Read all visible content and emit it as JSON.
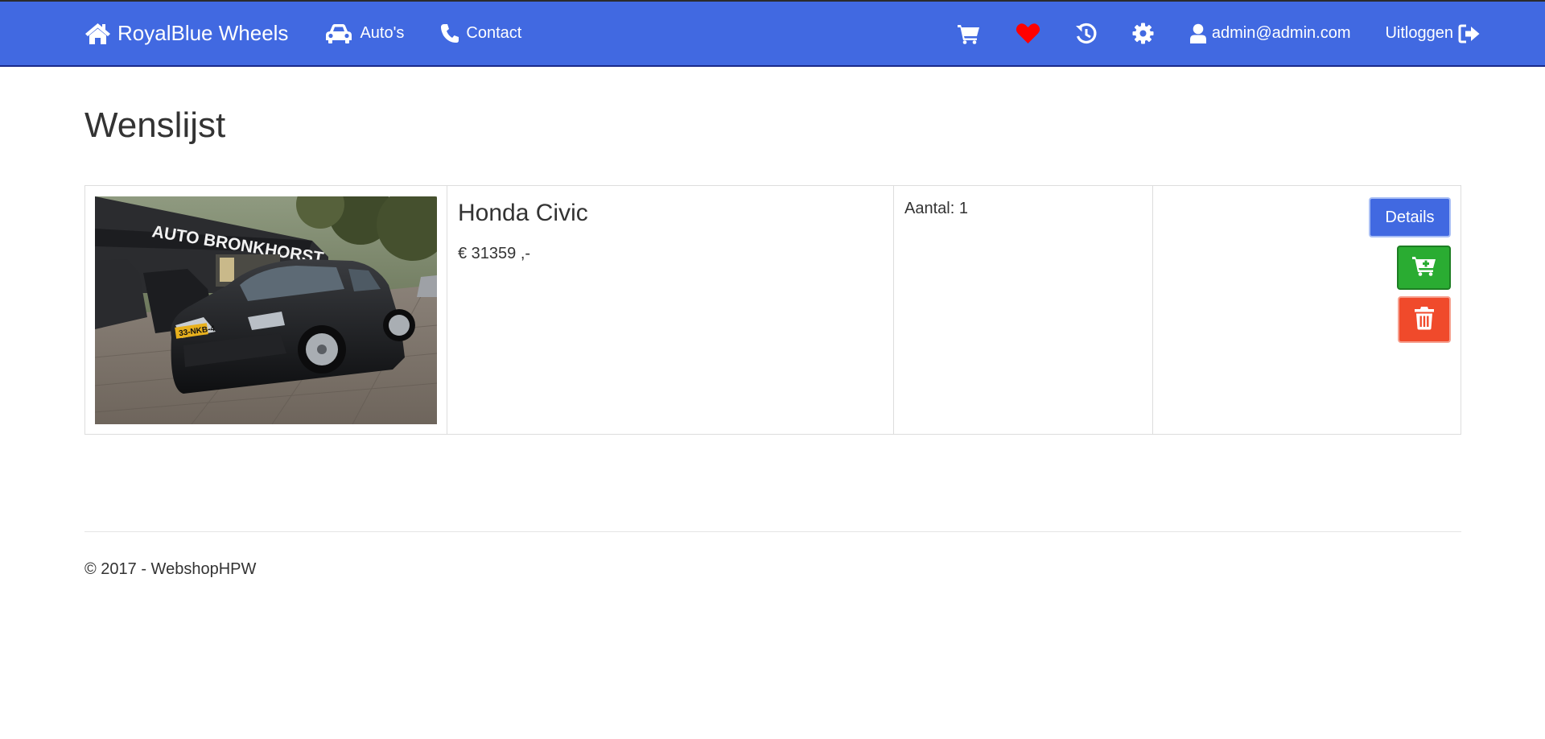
{
  "navbar": {
    "brand": "RoyalBlue Wheels",
    "links": [
      {
        "label": "Auto's",
        "icon": "car-icon"
      },
      {
        "label": "Contact",
        "icon": "phone-icon"
      }
    ],
    "user_email": "admin@admin.com",
    "logout_label": "Uitloggen",
    "icons": [
      "cart-icon",
      "heart-icon",
      "history-icon",
      "gear-icon",
      "user-icon",
      "logout-icon"
    ],
    "colors": {
      "background": "#4169e1",
      "heart": "#ff0000"
    }
  },
  "page": {
    "title": "Wenslijst"
  },
  "wishlist": {
    "items": [
      {
        "name": "Honda Civic",
        "price": "€ 31359 ,-",
        "quantity": "Aantal: 1",
        "photo_sign": "AUTO BRONKHORST",
        "plate": "33-NKB-4",
        "actions": {
          "details_label": "Details",
          "cart_icon": "cart-plus-icon",
          "delete_icon": "trash-icon"
        }
      }
    ]
  },
  "button_colors": {
    "details": "#4169e1",
    "add_to_cart": "#2aac32",
    "delete": "#f04a2b"
  },
  "footer": {
    "text": "© 2017 - WebshopHPW"
  }
}
